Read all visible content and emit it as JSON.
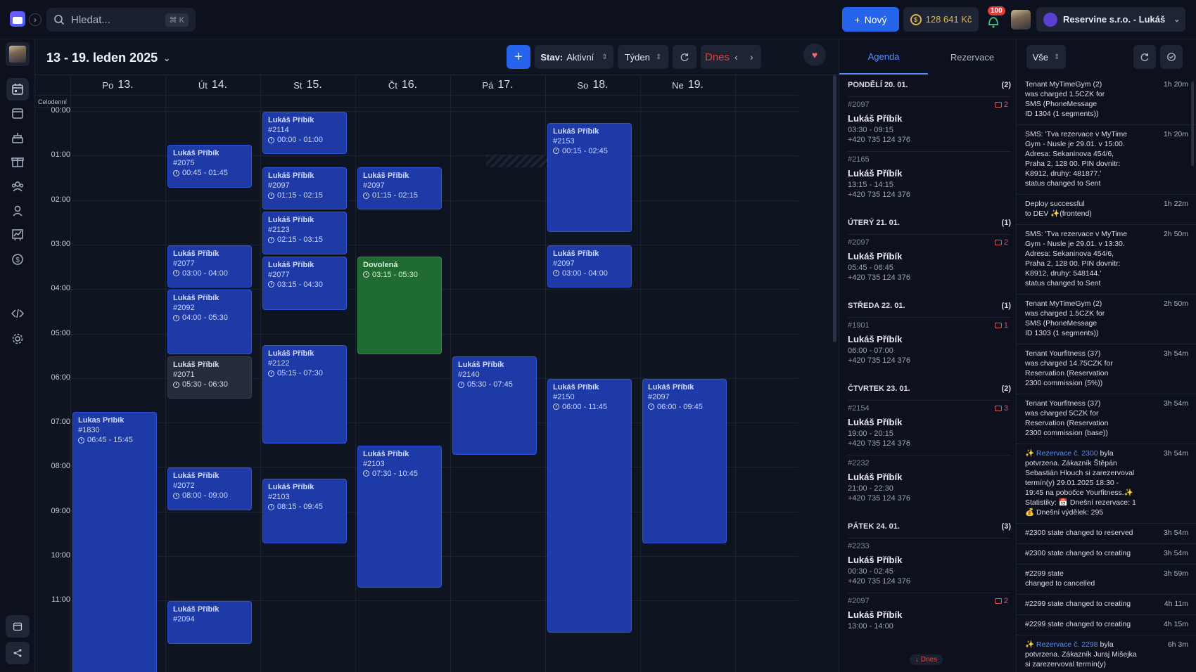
{
  "topbar": {
    "search_placeholder": "Hledat...",
    "search_shortcut": "⌘ K",
    "new_button": "Nový",
    "credit": "128 641 Kč",
    "notif_count": "100",
    "org_name": "Reservine s.r.o. - Lukáš"
  },
  "sidebar": {
    "items": [
      "calendar-week-icon",
      "calendar-icon",
      "cake-icon",
      "gift-icon",
      "users-icon",
      "user-icon",
      "chart-icon",
      "dollar-icon",
      "code-icon",
      "gear-icon"
    ]
  },
  "toolbar": {
    "range_title": "13 - 19. leden 2025",
    "status_label": "Stav:",
    "status_value": "Aktivní",
    "view_value": "Týden",
    "today_label": "Dnes"
  },
  "calendar": {
    "allday_label": "Celodenní",
    "days": [
      {
        "name": "Po",
        "num": "13."
      },
      {
        "name": "Út",
        "num": "14."
      },
      {
        "name": "St",
        "num": "15."
      },
      {
        "name": "Čt",
        "num": "16."
      },
      {
        "name": "Pá",
        "num": "17."
      },
      {
        "name": "So",
        "num": "18."
      },
      {
        "name": "Ne",
        "num": "19."
      }
    ],
    "hours": [
      "00:00",
      "01:00",
      "02:00",
      "03:00",
      "04:00",
      "05:00",
      "06:00",
      "07:00",
      "08:00",
      "09:00",
      "10:00",
      "11:00"
    ],
    "events": [
      {
        "day": 0,
        "name": "Lukas Pribik",
        "id": "#1830",
        "time": "06:45 - 15:45",
        "start": 6.75,
        "end": 15.75,
        "kind": "blue"
      },
      {
        "day": 1,
        "name": "Lukáš Příbík",
        "id": "#2075",
        "time": "00:45 - 01:45",
        "start": 0.75,
        "end": 1.75,
        "kind": "blue"
      },
      {
        "day": 1,
        "name": "Lukáš Příbík",
        "id": "#2077",
        "time": "03:00 - 04:00",
        "start": 3,
        "end": 4,
        "kind": "blue"
      },
      {
        "day": 1,
        "name": "Lukáš Příbík",
        "id": "#2092",
        "time": "04:00 - 05:30",
        "start": 4,
        "end": 5.5,
        "kind": "blue"
      },
      {
        "day": 1,
        "name": "Lukáš Příbík",
        "id": "#2071",
        "time": "05:30 - 06:30",
        "start": 5.5,
        "end": 6.5,
        "kind": "grey"
      },
      {
        "day": 1,
        "name": "Lukáš Příbík",
        "id": "#2072",
        "time": "08:00 - 09:00",
        "start": 8,
        "end": 9,
        "kind": "blue"
      },
      {
        "day": 1,
        "name": "Lukáš Příbík",
        "id": "#2094",
        "time": "",
        "start": 11,
        "end": 12,
        "kind": "blue"
      },
      {
        "day": 2,
        "name": "Lukáš Příbík",
        "id": "#2114",
        "time": "00:00 - 01:00",
        "start": 0,
        "end": 1,
        "kind": "blue"
      },
      {
        "day": 2,
        "name": "Lukáš Příbík",
        "id": "#2097",
        "time": "01:15 - 02:15",
        "start": 1.25,
        "end": 2.25,
        "kind": "blue"
      },
      {
        "day": 2,
        "name": "Lukáš Příbík",
        "id": "#2123",
        "time": "02:15 - 03:15",
        "start": 2.25,
        "end": 3.25,
        "kind": "blue"
      },
      {
        "day": 2,
        "name": "Lukáš Příbík",
        "id": "#2077",
        "time": "03:15 - 04:30",
        "start": 3.25,
        "end": 4.5,
        "kind": "blue"
      },
      {
        "day": 2,
        "name": "Lukáš Příbík",
        "id": "#2122",
        "time": "05:15 - 07:30",
        "start": 5.25,
        "end": 7.5,
        "kind": "blue"
      },
      {
        "day": 2,
        "name": "Lukáš Příbík",
        "id": "#2103",
        "time": "08:15 - 09:45",
        "start": 8.25,
        "end": 9.75,
        "kind": "blue"
      },
      {
        "day": 3,
        "name": "Lukáš Příbík",
        "id": "#2097",
        "time": "01:15 - 02:15",
        "start": 1.25,
        "end": 2.25,
        "kind": "blue"
      },
      {
        "day": 3,
        "name": "Dovolená",
        "id": "",
        "time": "03:15 - 05:30",
        "start": 3.25,
        "end": 5.5,
        "kind": "green"
      },
      {
        "day": 3,
        "name": "Lukáš Příbík",
        "id": "#2103",
        "time": "07:30 - 10:45",
        "start": 7.5,
        "end": 10.75,
        "kind": "blue"
      },
      {
        "day": 4,
        "name": "Lukáš Příbík",
        "id": "#2140",
        "time": "05:30 - 07:45",
        "start": 5.5,
        "end": 7.75,
        "kind": "blue"
      },
      {
        "day": 5,
        "name": "Lukáš Příbík",
        "id": "#2153",
        "time": "00:15 - 02:45",
        "start": 0.25,
        "end": 2.75,
        "kind": "blue"
      },
      {
        "day": 5,
        "name": "Lukáš Příbík",
        "id": "#2097",
        "time": "03:00 - 04:00",
        "start": 3,
        "end": 4,
        "kind": "blue"
      },
      {
        "day": 5,
        "name": "Lukáš Příbík",
        "id": "#2150",
        "time": "06:00 - 11:45",
        "start": 6,
        "end": 11.75,
        "kind": "blue"
      },
      {
        "day": 6,
        "name": "Lukáš Příbík",
        "id": "#2097",
        "time": "06:00 - 09:45",
        "start": 6,
        "end": 9.75,
        "kind": "blue"
      }
    ]
  },
  "agenda": {
    "tabs": [
      "Agenda",
      "Rezervace"
    ],
    "groups": [
      {
        "title": "PONDĚLÍ 20. 01.",
        "count": "(2)",
        "items": [
          {
            "id": "#2097",
            "comments": "2",
            "name": "Lukáš Příbík",
            "time": "03:30 - 09:15",
            "phone": "+420 735 124 376"
          },
          {
            "id": "#2165",
            "comments": "",
            "name": "Lukáš Příbík",
            "time": "13:15 - 14:15",
            "phone": "+420 735 124 376"
          }
        ]
      },
      {
        "title": "ÚTERÝ 21. 01.",
        "count": "(1)",
        "items": [
          {
            "id": "#2097",
            "comments": "2",
            "name": "Lukáš Příbík",
            "time": "05:45 - 06:45",
            "phone": "+420 735 124 376"
          }
        ]
      },
      {
        "title": "STŘEDA 22. 01.",
        "count": "(1)",
        "items": [
          {
            "id": "#1901",
            "comments": "1",
            "name": "Lukáš Příbík",
            "time": "06:00 - 07:00",
            "phone": "+420 735 124 376"
          }
        ]
      },
      {
        "title": "ČTVRTEK 23. 01.",
        "count": "(2)",
        "items": [
          {
            "id": "#2154",
            "comments": "3",
            "name": "Lukáš Příbík",
            "time": "19:00 - 20:15",
            "phone": "+420 735 124 376"
          },
          {
            "id": "#2232",
            "comments": "",
            "name": "Lukáš Příbík",
            "time": "21:00 - 22:30",
            "phone": "+420 735 124 376"
          }
        ]
      },
      {
        "title": "PÁTEK 24. 01.",
        "count": "(3)",
        "items": [
          {
            "id": "#2233",
            "comments": "",
            "name": "Lukáš Příbík",
            "time": "00:30 - 02:45",
            "phone": "+420 735 124 376"
          },
          {
            "id": "#2097",
            "comments": "2",
            "name": "Lukáš Příbík",
            "time": "13:00 - 14:00",
            "phone": ""
          }
        ]
      }
    ],
    "today_pill": "↓ Dnes"
  },
  "log": {
    "filter": "Vše",
    "entries": [
      {
        "lines": [
          "Tenant MyTimeGym (2)",
          "was charged 1.5CZK for",
          "SMS (PhoneMessage",
          "ID 1304 (1 segments))"
        ],
        "time": "1h 20m"
      },
      {
        "lines": [
          "SMS: 'Tva rezervace v MyTime",
          "Gym - Nusle je 29.01. v 15:00.",
          "Adresa: Sekaninova 454/6,",
          "Praha 2, 128 00. PIN dovnitr:",
          "K8912, druhy: 481877.'",
          "status changed to Sent"
        ],
        "time": "1h 20m"
      },
      {
        "lines": [
          "Deploy successful",
          "to DEV ✨(frontend)"
        ],
        "time": "1h 22m"
      },
      {
        "lines": [
          "SMS: 'Tva rezervace v MyTime",
          "Gym - Nusle je 29.01. v 13:30.",
          "Adresa: Sekaninova 454/6,",
          "Praha 2, 128 00. PIN dovnitr:",
          "K8912, druhy: 548144.'",
          "status changed to Sent"
        ],
        "time": "2h 50m"
      },
      {
        "lines": [
          "Tenant MyTimeGym (2)",
          "was charged 1.5CZK for",
          "SMS (PhoneMessage",
          "ID 1303 (1 segments))"
        ],
        "time": "2h 50m"
      },
      {
        "lines": [
          "Tenant Yourfitness (37)",
          "was charged 14.75CZK for",
          "Reservation (Reservation",
          "2300 commission (5%))"
        ],
        "time": "3h 54m"
      },
      {
        "lines": [
          "Tenant Yourfitness (37)",
          "was charged 5CZK for",
          "Reservation (Reservation",
          "2300 commission (base))"
        ],
        "time": "3h 54m"
      },
      {
        "lines": [
          "✨ Rezervace č. 2300 byla",
          "potvrzena. Zákazník Štěpán",
          "Sebastián Hlouch si zarezervoval",
          "termín(y) 29.01.2025 18:30 -",
          "19:45 na pobočce Yourfitness.✨",
          "Statistiky: 📅 Dnešní rezervace: 1",
          "💰 Dnešní výdělek: 295"
        ],
        "time": "3h 54m"
      },
      {
        "lines": [
          "#2300 state changed to reserved"
        ],
        "time": "3h 54m"
      },
      {
        "lines": [
          "#2300 state changed to creating"
        ],
        "time": "3h 54m"
      },
      {
        "lines": [
          "#2299 state",
          "changed to cancelled"
        ],
        "time": "3h 59m"
      },
      {
        "lines": [
          "#2299 state changed to creating"
        ],
        "time": "4h 11m"
      },
      {
        "lines": [
          "#2299 state changed to creating"
        ],
        "time": "4h 15m"
      },
      {
        "lines": [
          "✨ Rezervace č. 2298 byla",
          "potvrzena. Zákazník Juraj Mišejka",
          "si zarezervoval termín(y)"
        ],
        "time": "6h 3m"
      }
    ]
  }
}
